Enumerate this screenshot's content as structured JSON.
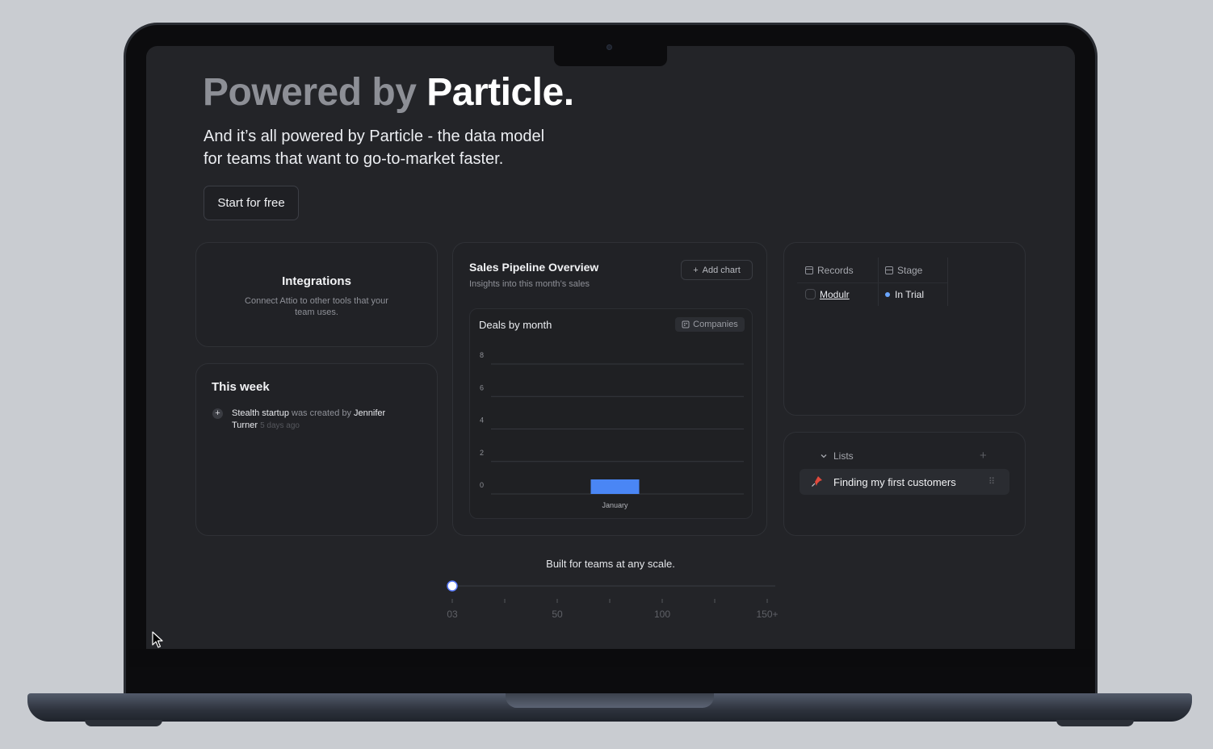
{
  "hero": {
    "title_muted": "Powered by",
    "title_bright": "Particle.",
    "subtitle_line1": "And it’s all powered by Particle - the data model",
    "subtitle_line2": "for teams that want to go-to-market faster.",
    "cta_label": "Start for free"
  },
  "integrations": {
    "title": "Integrations",
    "description": "Connect Attio to other tools that your team uses."
  },
  "this_week": {
    "title": "This week",
    "entry_subject": "Stealth startup",
    "entry_action": "was created by",
    "entry_actor": "Jennifer Turner",
    "entry_time": "5 days ago"
  },
  "sales": {
    "title": "Sales Pipeline Overview",
    "subtitle": "Insights into this month’s sales",
    "add_chart_label": "Add chart",
    "chart_title": "Deals by month",
    "companies_label": "Companies"
  },
  "chart_data": {
    "type": "bar",
    "title": "Deals by month",
    "categories": [
      "January"
    ],
    "values": [
      0.45
    ],
    "yticks": [
      0,
      2,
      4,
      6,
      8
    ],
    "ylim": [
      0,
      8
    ],
    "xlabel": "",
    "ylabel": "",
    "grid": true,
    "bar_color": "#4a86f5"
  },
  "records": {
    "col1_header": "Records",
    "col2_header": "Stage",
    "row_name": "Modulr",
    "row_stage": "In Trial",
    "stage_color": "#6aa6ff"
  },
  "lists": {
    "header": "Lists",
    "item_label": "Finding my first customers"
  },
  "scale": {
    "caption": "Built for teams at any scale.",
    "labels": [
      "03",
      "50",
      "100",
      "150+"
    ],
    "value_fraction": 0
  },
  "icons": [
    "plus-icon",
    "building-icon",
    "table-icon",
    "pin-icon",
    "chevron-down-icon",
    "grip-icon",
    "cursor-icon"
  ]
}
